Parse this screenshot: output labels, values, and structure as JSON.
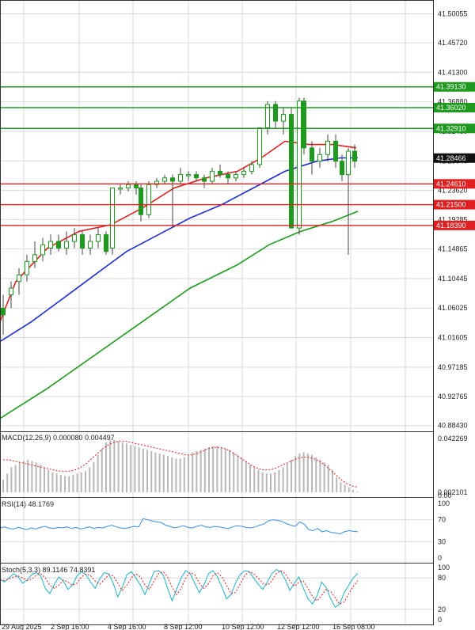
{
  "chart_data": {
    "type": "candlestick",
    "main": {
      "y_ticks": [
        "41.50055",
        "41.45720",
        "41.41300",
        "41.36880",
        "41.32460",
        "41.28040",
        "41.23620",
        "41.19285",
        "41.14865",
        "41.10445",
        "41.06025",
        "41.01605",
        "40.97185",
        "40.92765",
        "40.88430"
      ],
      "current_price": "41.28466",
      "ylim": [
        40.8757,
        41.5213
      ],
      "support_resistance": [
        {
          "label": "41.39130",
          "value": 41.3913,
          "color": "#1e9a1e"
        },
        {
          "label": "41.36020",
          "value": 41.3602,
          "color": "#1e9a1e"
        },
        {
          "label": "41.32910",
          "value": 41.3291,
          "color": "#1e9a1e"
        },
        {
          "label": "41.24610",
          "value": 41.2461,
          "color": "#e02020"
        },
        {
          "label": "41.21500",
          "value": 41.215,
          "color": "#e02020"
        },
        {
          "label": "41.18390",
          "value": 41.1839,
          "color": "#e02020"
        }
      ],
      "series": [
        {
          "name": "MA fast",
          "color": "#e02020",
          "values": [
            [
              0,
              41.04
            ],
            [
              20,
              41.1
            ],
            [
              60,
              41.15
            ],
            [
              100,
              41.175
            ],
            [
              140,
              41.185
            ],
            [
              180,
              41.21
            ],
            [
              220,
              41.24
            ],
            [
              260,
              41.255
            ],
            [
              300,
              41.265
            ],
            [
              330,
              41.285
            ],
            [
              360,
              41.31
            ],
            [
              390,
              41.305
            ],
            [
              420,
              41.305
            ],
            [
              450,
              41.3
            ]
          ]
        },
        {
          "name": "MA mid",
          "color": "#1f2fd0",
          "values": [
            [
              0,
              41.01
            ],
            [
              40,
              41.04
            ],
            [
              80,
              41.075
            ],
            [
              120,
              41.11
            ],
            [
              160,
              41.145
            ],
            [
              200,
              41.17
            ],
            [
              240,
              41.195
            ],
            [
              280,
              41.215
            ],
            [
              320,
              41.24
            ],
            [
              360,
              41.265
            ],
            [
              400,
              41.28
            ],
            [
              430,
              41.285
            ],
            [
              452,
              41.285
            ]
          ]
        },
        {
          "name": "MA slow",
          "color": "#1e9a1e",
          "values": [
            [
              0,
              40.895
            ],
            [
              60,
              40.94
            ],
            [
              120,
              40.99
            ],
            [
              180,
              41.04
            ],
            [
              240,
              41.09
            ],
            [
              300,
              41.125
            ],
            [
              340,
              41.155
            ],
            [
              380,
              41.175
            ],
            [
              420,
              41.19
            ],
            [
              452,
              41.205
            ]
          ]
        }
      ],
      "candles": [
        [
          4,
          41.06,
          41.08,
          41.02,
          41.05
        ],
        [
          14,
          41.08,
          41.1,
          41.06,
          41.09
        ],
        [
          24,
          41.1,
          41.12,
          41.08,
          41.11
        ],
        [
          34,
          41.11,
          41.14,
          41.1,
          41.13
        ],
        [
          44,
          41.13,
          41.16,
          41.12,
          41.14
        ],
        [
          54,
          41.14,
          41.165,
          41.13,
          41.155
        ],
        [
          64,
          41.15,
          41.17,
          41.14,
          41.16
        ],
        [
          74,
          41.16,
          41.17,
          41.145,
          41.15
        ],
        [
          84,
          41.15,
          41.175,
          41.14,
          41.16
        ],
        [
          94,
          41.16,
          41.18,
          41.15,
          41.17
        ],
        [
          104,
          41.17,
          41.175,
          41.14,
          41.15
        ],
        [
          114,
          41.15,
          41.17,
          41.14,
          41.16
        ],
        [
          124,
          41.16,
          41.18,
          41.15,
          41.17
        ],
        [
          134,
          41.17,
          41.175,
          41.14,
          41.145
        ],
        [
          142,
          41.15,
          41.24,
          41.14,
          41.24
        ],
        [
          152,
          41.24,
          41.245,
          41.23,
          41.24
        ],
        [
          162,
          41.24,
          41.25,
          41.235,
          41.245
        ],
        [
          172,
          41.245,
          41.25,
          41.23,
          41.24
        ],
        [
          178,
          41.24,
          41.245,
          41.19,
          41.2
        ],
        [
          188,
          41.2,
          41.25,
          41.195,
          41.245
        ],
        [
          198,
          41.245,
          41.255,
          41.24,
          41.25
        ],
        [
          208,
          41.25,
          41.26,
          41.245,
          41.255
        ],
        [
          218,
          41.255,
          41.26,
          41.18,
          41.25
        ],
        [
          228,
          41.25,
          41.27,
          41.245,
          41.26
        ],
        [
          238,
          41.26,
          41.265,
          41.25,
          41.26
        ],
        [
          248,
          41.26,
          41.265,
          41.25,
          41.255
        ],
        [
          258,
          41.255,
          41.26,
          41.24,
          41.25
        ],
        [
          268,
          41.25,
          41.27,
          41.245,
          41.265
        ],
        [
          278,
          41.265,
          41.275,
          41.255,
          41.26
        ],
        [
          288,
          41.26,
          41.265,
          41.245,
          41.255
        ],
        [
          298,
          41.255,
          41.265,
          41.25,
          41.26
        ],
        [
          308,
          41.26,
          41.27,
          41.255,
          41.265
        ],
        [
          318,
          41.265,
          41.28,
          41.26,
          41.275
        ],
        [
          328,
          41.275,
          41.33,
          41.27,
          41.33
        ],
        [
          338,
          41.33,
          41.37,
          41.32,
          41.365
        ],
        [
          348,
          41.365,
          41.37,
          41.33,
          41.34
        ],
        [
          358,
          41.34,
          41.36,
          41.32,
          41.35
        ],
        [
          368,
          41.35,
          41.36,
          41.18,
          41.18
        ],
        [
          378,
          41.18,
          41.375,
          41.17,
          41.37
        ],
        [
          384,
          41.37,
          41.375,
          41.29,
          41.3
        ],
        [
          394,
          41.3,
          41.31,
          41.26,
          41.28
        ],
        [
          404,
          41.28,
          41.3,
          41.27,
          41.29
        ],
        [
          414,
          41.29,
          41.32,
          41.28,
          41.31
        ],
        [
          424,
          41.31,
          41.32,
          41.27,
          41.28
        ],
        [
          432,
          41.28,
          41.29,
          41.25,
          41.26
        ],
        [
          440,
          41.26,
          41.3,
          41.14,
          41.295
        ],
        [
          448,
          41.295,
          41.305,
          41.27,
          41.28
        ]
      ]
    },
    "macd": {
      "label": "MACD(12,26,9) 0.000080 0.004497",
      "top_value": "0.042269",
      "bottom_value": "0.002101",
      "zero_label": "0.00",
      "histogram": [
        0.01,
        0.015,
        0.02,
        0.022,
        0.024,
        0.025,
        0.026,
        0.025,
        0.024,
        0.022,
        0.02,
        0.018,
        0.016,
        0.015,
        0.014,
        0.013,
        0.013,
        0.014,
        0.015,
        0.016,
        0.017,
        0.02,
        0.024,
        0.03,
        0.035,
        0.04,
        0.042,
        0.042,
        0.041,
        0.04,
        0.039,
        0.038,
        0.037,
        0.036,
        0.035,
        0.034,
        0.033,
        0.032,
        0.031,
        0.03,
        0.029,
        0.028,
        0.027,
        0.027,
        0.028,
        0.03,
        0.032,
        0.033,
        0.034,
        0.035,
        0.036,
        0.037,
        0.037,
        0.036,
        0.035,
        0.034,
        0.032,
        0.03,
        0.028,
        0.025,
        0.022,
        0.02,
        0.018,
        0.016,
        0.015,
        0.015,
        0.016,
        0.018,
        0.02,
        0.023,
        0.026,
        0.029,
        0.031,
        0.032,
        0.031,
        0.03,
        0.028,
        0.026,
        0.024,
        0.022,
        0.018,
        0.012,
        0.008,
        0.006,
        0.004,
        0.002,
        0.0005
      ],
      "signal": [
        0.026,
        0.026,
        0.025,
        0.024,
        0.023,
        0.022,
        0.021,
        0.02,
        0.019,
        0.018,
        0.017,
        0.017,
        0.017,
        0.018,
        0.02,
        0.023,
        0.027,
        0.031,
        0.035,
        0.038,
        0.04,
        0.041,
        0.041,
        0.04,
        0.039,
        0.038,
        0.037,
        0.036,
        0.035,
        0.034,
        0.033,
        0.032,
        0.031,
        0.03,
        0.03,
        0.031,
        0.033,
        0.035,
        0.036,
        0.036,
        0.035,
        0.033,
        0.03,
        0.027,
        0.024,
        0.021,
        0.019,
        0.018,
        0.018,
        0.019,
        0.021,
        0.023,
        0.025,
        0.027,
        0.028,
        0.028,
        0.027,
        0.025,
        0.022,
        0.018,
        0.014,
        0.01,
        0.007,
        0.005,
        0.004
      ]
    },
    "rsi": {
      "label": "RSI(14) 48.1769",
      "ticks": [
        "100",
        "70",
        "30",
        "0"
      ],
      "values": [
        55,
        57,
        54,
        53,
        56,
        54,
        52,
        55,
        53,
        56,
        58,
        55,
        54,
        56,
        55,
        57,
        54,
        56,
        53,
        55,
        57,
        54,
        56,
        55,
        58,
        60,
        57,
        55,
        54,
        56,
        58,
        57,
        72,
        70,
        68,
        66,
        65,
        60,
        58,
        55,
        57,
        59,
        56,
        55,
        58,
        60,
        57,
        56,
        58,
        57,
        55,
        54,
        57,
        59,
        58,
        56,
        55,
        57,
        60,
        62,
        68,
        70,
        69,
        67,
        63,
        60,
        58,
        66,
        62,
        52,
        50,
        54,
        48,
        50,
        47,
        46,
        44,
        48,
        50,
        49,
        48
      ]
    },
    "stoch": {
      "label": "Stoch(5,3,3) 89.1146 74.8391",
      "ticks": [
        "100",
        "80",
        "20",
        "0"
      ],
      "k": [
        78,
        72,
        80,
        88,
        82,
        70,
        76,
        86,
        90,
        84,
        60,
        50,
        68,
        82,
        74,
        58,
        66,
        84,
        92,
        86,
        72,
        60,
        78,
        90,
        88,
        70,
        44,
        62,
        86,
        92,
        80,
        66,
        48,
        70,
        92,
        94,
        86,
        60,
        36,
        58,
        80,
        94,
        88,
        70,
        52,
        66,
        88,
        94,
        82,
        62,
        40,
        48,
        70,
        86,
        94,
        92,
        80,
        68,
        58,
        72,
        88,
        96,
        92,
        76,
        56,
        70,
        82,
        60,
        40,
        30,
        46,
        72,
        62,
        40,
        24,
        30,
        52,
        66,
        80,
        89
      ],
      "d": [
        76,
        75,
        78,
        82,
        84,
        80,
        75,
        78,
        85,
        88,
        80,
        66,
        60,
        66,
        76,
        72,
        66,
        70,
        82,
        88,
        84,
        74,
        68,
        76,
        86,
        84,
        70,
        56,
        66,
        80,
        88,
        82,
        66,
        58,
        74,
        88,
        92,
        82,
        62,
        48,
        60,
        80,
        90,
        86,
        70,
        60,
        68,
        84,
        90,
        82,
        66,
        50,
        52,
        68,
        84,
        92,
        88,
        80,
        70,
        66,
        74,
        88,
        94,
        88,
        74,
        64,
        72,
        74,
        60,
        44,
        36,
        46,
        58,
        54,
        42,
        30,
        34,
        50,
        64,
        75
      ]
    },
    "x_labels": [
      "29 Aug 2025",
      "2 Sep 16:00",
      "4 Sep 16:00",
      "8 Sep 12:00",
      "10 Sep 12:00",
      "12 Sep 12:00",
      "16 Sep 08:00"
    ],
    "colors": {
      "bull": "#1e9a1e",
      "bear": "#1e9a1e",
      "grid": "#d9d9d9",
      "frame": "#333333"
    }
  }
}
